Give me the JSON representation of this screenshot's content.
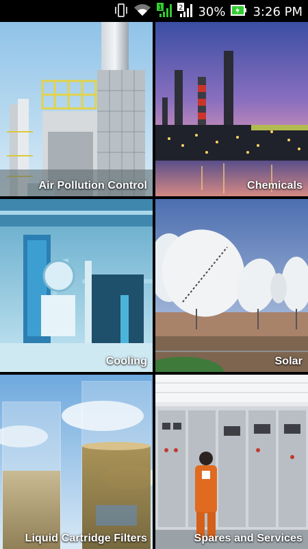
{
  "status_bar": {
    "battery": "30%",
    "time": "3:26 PM",
    "icons": [
      "vibrate-icon",
      "wifi-icon",
      "signal-1-icon",
      "signal-2-icon",
      "battery-charging-icon"
    ]
  },
  "tiles": [
    {
      "label": "Air Pollution Control"
    },
    {
      "label": "Chemicals"
    },
    {
      "label": "Cooling"
    },
    {
      "label": "Solar"
    },
    {
      "label": "Liquid Cartridge Filters"
    },
    {
      "label": "Spares and Services"
    }
  ]
}
